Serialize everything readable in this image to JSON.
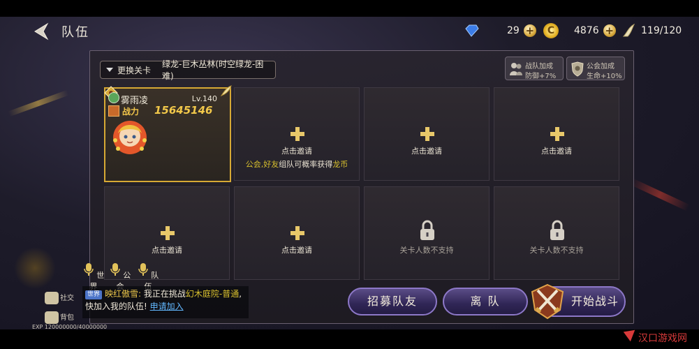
{
  "header": {
    "title": "队伍"
  },
  "resources": {
    "gems": "29",
    "coins": "4876",
    "coin_glyph": "C",
    "stamina": "119/120"
  },
  "stage": {
    "change_label": "更换关卡",
    "name": "绿龙-巨木丛林(时空绿龙-困难)"
  },
  "buffs": [
    {
      "line1": "战队加成",
      "line2": "防御+7%"
    },
    {
      "line1": "公会加成",
      "line2": "生命+10%"
    }
  ],
  "leader": {
    "name": "雾雨凌",
    "level": "Lv.140",
    "power_label": "战力",
    "power": "15645146"
  },
  "slots": {
    "invite": "点击邀请",
    "hint_a": "公会,",
    "hint_b": "好友",
    "hint_c": "组队可概率获得",
    "hint_d": "龙币",
    "locked": "关卡人数不支持"
  },
  "chat": {
    "channels": [
      "世界",
      "公会",
      "队伍"
    ],
    "tag": "世界",
    "sender": "映红傲雪:",
    "text1": " 我正在挑战",
    "place": "幻木庭院-普通",
    "text2": ",快加入我的队伍!",
    "link": "申请加入"
  },
  "side": {
    "social": "社交",
    "bag": "背包"
  },
  "exp": "EXP 120000000/40000000",
  "actions": {
    "recruit": "招募队友",
    "leave": "离 队",
    "start": "开始战斗"
  },
  "watermark": "汉口游戏网"
}
